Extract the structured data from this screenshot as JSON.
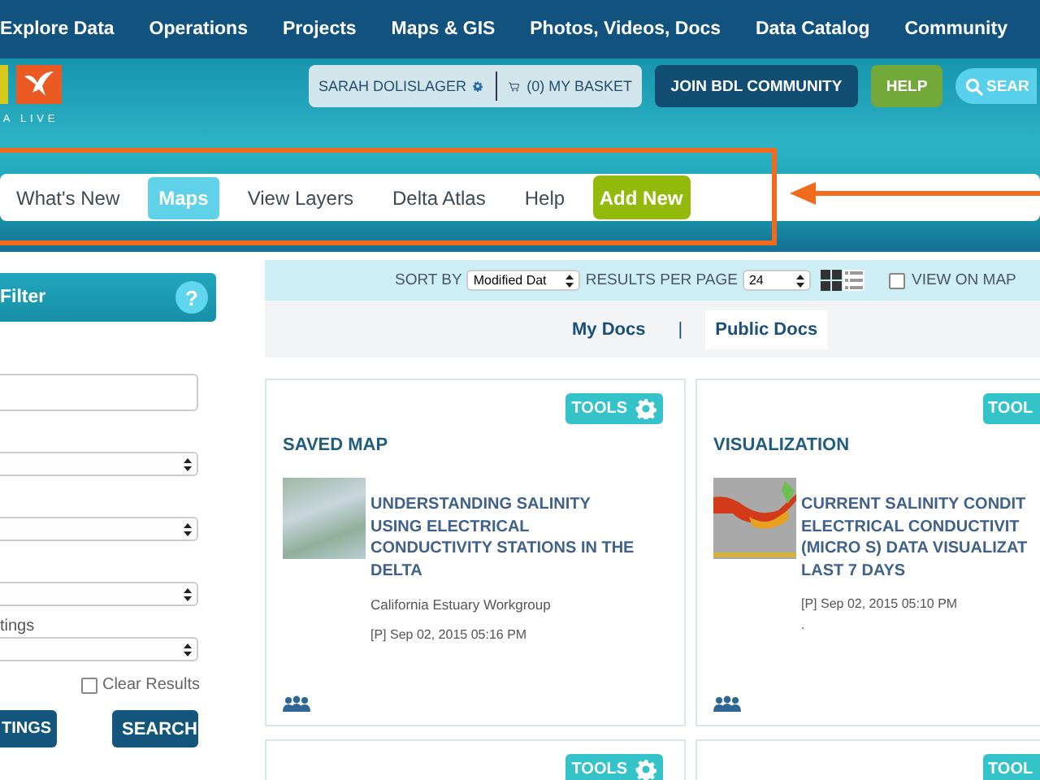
{
  "top_nav": {
    "items": [
      "Explore Data",
      "Operations",
      "Projects",
      "Maps & GIS",
      "Photos, Videos, Docs",
      "Data Catalog",
      "Community"
    ]
  },
  "header": {
    "logo_text": "A LIVE",
    "user": "SARAH DOLISLAGER",
    "basket": "(0) MY BASKET",
    "join_button": "JOIN BDL COMMUNITY",
    "help_button": "HELP",
    "search_button": "SEAR"
  },
  "sub_nav": {
    "items": [
      {
        "label": "What's New",
        "kind": "link",
        "selected": false
      },
      {
        "label": "Maps",
        "kind": "link",
        "selected": true
      },
      {
        "label": "View Layers",
        "kind": "link",
        "selected": false
      },
      {
        "label": "Delta Atlas",
        "kind": "link",
        "selected": false
      },
      {
        "label": "Help",
        "kind": "link",
        "selected": false
      },
      {
        "label": "Add New",
        "kind": "button",
        "selected": false
      }
    ]
  },
  "filter_panel": {
    "title": "Filter",
    "help": "?",
    "fields": [
      {
        "kind": "text"
      },
      {
        "kind": "select"
      },
      {
        "kind": "select"
      },
      {
        "kind": "select"
      },
      {
        "kind": "select",
        "label": "tings"
      }
    ],
    "clear_results": {
      "label": "Clear Results",
      "checked": false
    },
    "buttons": [
      "TINGS",
      "SEARCH"
    ]
  },
  "toolbar": {
    "sort_label": "SORT BY",
    "sort_value": "Modified Dat",
    "per_page_label": "RESULTS PER PAGE",
    "per_page_value": "24",
    "view_modes": [
      {
        "kind": "grid",
        "selected": true
      },
      {
        "kind": "list",
        "selected": false
      }
    ],
    "view_on_map": {
      "label": "VIEW ON MAP",
      "checked": false
    }
  },
  "doc_tabs": {
    "separator": "|",
    "items": [
      {
        "label": "My Docs",
        "selected": false
      },
      {
        "label": "Public Docs",
        "selected": true
      }
    ]
  },
  "cards": [
    {
      "tools": "TOOLS",
      "type": "SAVED MAP",
      "kind": "photo",
      "title_lines": [
        "UNDERSTANDING SALINITY",
        "USING ELECTRICAL",
        "CONDUCTIVITY STATIONS IN THE",
        "DELTA"
      ],
      "author": "California Estuary Workgroup",
      "date": "[P] Sep 02, 2015 05:16 PM"
    },
    {
      "tools": "TOOL",
      "type": "VISUALIZATION",
      "kind": "map",
      "title_lines": [
        "CURRENT SALINITY CONDIT",
        "ELECTRICAL CONDUCTIVIT",
        "(MICRO S) DATA VISUALIZAT",
        "LAST 7 DAYS"
      ],
      "date": "[P] Sep 02, 2015 05:10 PM",
      "note": "."
    },
    {
      "tools": "TOOLS"
    },
    {
      "tools": "TOOL"
    }
  ]
}
